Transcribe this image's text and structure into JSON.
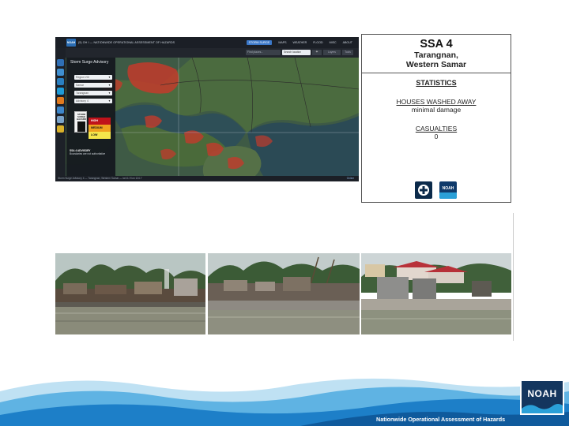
{
  "map": {
    "logo_text": "NOAH",
    "title": "(5) OH I — NATIONWIDE OPERATIONAL ASSESSMENT OF HAZARDS",
    "nav": [
      "STORM SURGE",
      "MAPS",
      "WEATHER",
      "FLOOD",
      "MISC",
      "ABOUT"
    ],
    "search_placeholder": "Find places...",
    "search_button": "Search location",
    "zoom_in": "+",
    "layer_button": "Layers",
    "tools_button": "Tools",
    "legend": {
      "title": "Storm Surge Advisory",
      "selects": [
        "Region VIII",
        "Samar",
        "Tarangnan",
        "Advisory 4"
      ],
      "hazard_sign": "STORM SURGE HAZARD",
      "levels": [
        "HIGH",
        "MEDIUM",
        "LOW"
      ],
      "note_bold": "SSA 4 ADVISORY",
      "note": "Boundaries are not authoritative"
    },
    "status": "Storm Surge Advisory 4 — Tarangnan, Western Samar — lat 11.9 lon 124.7",
    "status_right": "Online"
  },
  "ssa": {
    "title": "SSA 4",
    "location_line1": "Tarangnan,",
    "location_line2": "Western Samar",
    "statistics_heading": "STATISTICS",
    "houses_label": "HOUSES WASHED AWAY",
    "houses_value": "minimal damage",
    "casualties_label": "CASUALTIES",
    "casualties_value": "0"
  },
  "logos": {
    "noah_small": "NOAH",
    "noah_large": "NOAH"
  },
  "footer": {
    "caption": "Nationwide Operational Assessment of Hazards"
  },
  "colors": {
    "accent_blue": "#2b7ccf",
    "hazard_high": "#c0121a",
    "hazard_medium": "#f0a21e",
    "hazard_low": "#f5e64b"
  }
}
